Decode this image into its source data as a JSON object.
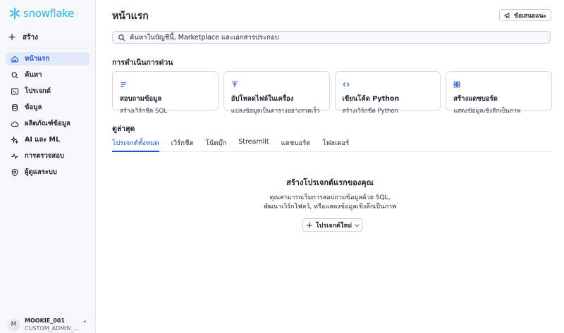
{
  "brand": {
    "name": "snowflake",
    "color": "#29b5e8"
  },
  "sidebar": {
    "create_label": "สร้าง",
    "items": [
      {
        "label": "หน้าแรก",
        "icon": "home-icon",
        "active": true
      },
      {
        "label": "ค้นหา",
        "icon": "search-icon"
      },
      {
        "label": "โปรเจกต์",
        "icon": "terminal-icon"
      },
      {
        "label": "ข้อมูล",
        "icon": "database-icon"
      },
      {
        "label": "ผลิตภัณฑ์ข้อมูล",
        "icon": "cloud-icon"
      },
      {
        "label": "AI และ ML",
        "icon": "sparkle-icon"
      },
      {
        "label": "การตรวจสอบ",
        "icon": "activity-icon"
      },
      {
        "label": "ผู้ดูแลระบบ",
        "icon": "shield-icon"
      }
    ],
    "user": {
      "initial": "M",
      "name": "MOOKIE_001",
      "role": "CUSTOM_ADMIN_..."
    }
  },
  "header": {
    "title": "หน้าแรก",
    "feedback_label": "ข้อเสนอแนะ"
  },
  "search": {
    "placeholder": "ค้นหาในบัญชีนี้, Marketplace และเอกสารประกอบ"
  },
  "quick_actions": {
    "title": "การดำเนินการด่วน",
    "cards": [
      {
        "title": "สอบถามข้อมูล",
        "subtitle": "สร้างเวิร์กชีต SQL",
        "icon": "lines-icon"
      },
      {
        "title": "อัปโหลดไฟล์ในเครื่อง",
        "subtitle": "แปลงข้อมูลเป็นตารางอย่างรวดเร็ว",
        "icon": "upload-icon"
      },
      {
        "title": "เขียนโค้ด Python",
        "subtitle": "สร้างเวิร์กชีต Python",
        "icon": "code-icon"
      },
      {
        "title": "สร้างแดชบอร์ด",
        "subtitle": "แสดงข้อมูลเชิงลึกเป็นภาพ",
        "icon": "grid-icon"
      }
    ]
  },
  "recent": {
    "title": "ดูล่าสุด",
    "tabs": [
      "โปรเจกต์ทั้งหมด",
      "เวิร์กชีต",
      "โน้ตบุ๊ก",
      "Streamlit",
      "แดชบอร์ด",
      "โฟลเดอร์"
    ],
    "active_tab": 0
  },
  "empty_state": {
    "title": "สร้างโปรเจกต์แรกของคุณ",
    "line1": "คุณสามารถเริ่มการสอบถามข้อมูลด้วย SQL,",
    "line2": "พัฒนาเวิร์กโฟลว์, หรือแสดงข้อมูลเชิงลึกเป็นภาพ",
    "button_label": "โปรเจกต์ใหม่"
  },
  "colors": {
    "accent": "#1a56db",
    "active_bg": "#e1e9fb"
  }
}
